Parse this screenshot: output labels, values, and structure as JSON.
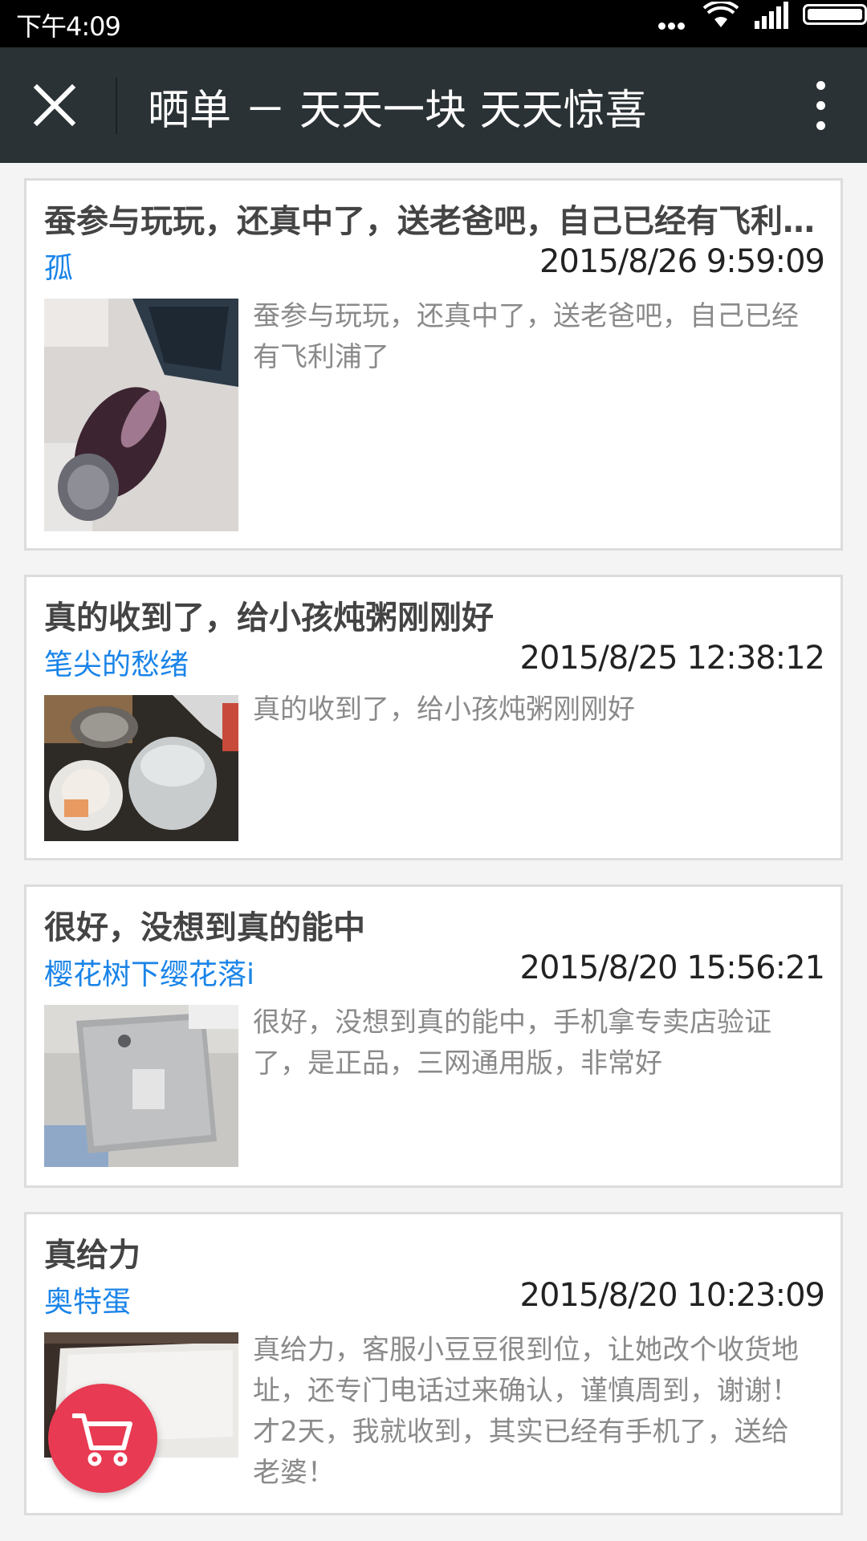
{
  "status_bar": {
    "time": "下午4:09",
    "icons": [
      "more-dots-icon",
      "wifi-icon",
      "signal-icon",
      "battery-icon"
    ]
  },
  "navbar": {
    "title": "晒单 － 天天一块 天天惊喜",
    "close_icon": "close-icon",
    "more_icon": "more-vertical-icon"
  },
  "posts": [
    {
      "title": "蚕参与玩玩，还真中了，送老爸吧，自己已经有飞利浦了",
      "user": "孤",
      "date": "2015/8/26 9:59:09",
      "body": "蚕参与玩玩，还真中了，送老爸吧，自己已经有飞利浦了",
      "image": "shaver-photo"
    },
    {
      "title": "真的收到了，给小孩炖粥刚刚好",
      "user": "笔尖的愁绪",
      "date": "2015/8/25 12:38:12",
      "body": "真的收到了，给小孩炖粥刚刚好",
      "image": "slow-cooker-photo"
    },
    {
      "title": "很好，没想到真的能中",
      "user": "樱花树下缨花落i",
      "date": "2015/8/20 15:56:21",
      "body": "很好，没想到真的能中，手机拿专卖店验证了，是正品，三网通用版，非常好",
      "image": "phone-photo"
    },
    {
      "title": "真给力",
      "user": "奥特蛋",
      "date": "2015/8/20 10:23:09",
      "body": "真给力，客服小豆豆很到位，让她改个收货地址，还专门电话过来确认，谨慎周到，谢谢！才2天，我就收到，其实已经有手机了，送给老婆！",
      "image": "phone-box-photo"
    }
  ],
  "cart_button": {
    "icon": "shopping-cart-icon",
    "color": "#e83a52"
  },
  "colors": {
    "accent_link": "#1a84e8",
    "navbar_bg": "#2b3235"
  }
}
